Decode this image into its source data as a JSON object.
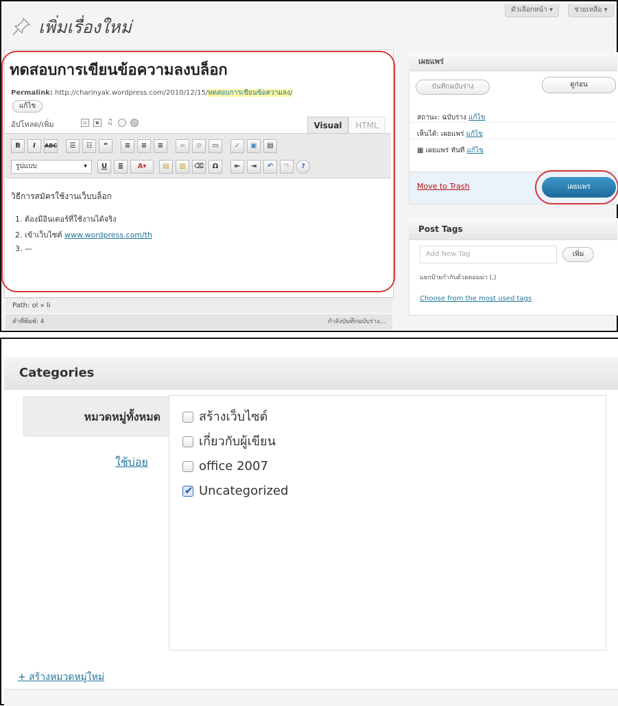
{
  "header": {
    "screen_options_label": "ตัวเลือกหน้า",
    "help_label": "ช่วยเหลือ",
    "page_title": "เพิ่มเรื่องใหม่"
  },
  "editor": {
    "post_title": "ทดสอบการเขียนข้อความลงบล็อก",
    "permalink_label": "Permalink:",
    "permalink_url": "http://charinyak.wordpress.com/2010/12/15/",
    "permalink_slug": "ทดสอบการเขียนข้อความลง/",
    "edit_permalink_label": "แก้ไข",
    "upload_label": "อัปโหลด/เพิ่ม",
    "tab_visual": "Visual",
    "tab_html": "HTML",
    "format_select": "รูปแบบ",
    "body_line1": "วิธีการสมัครใช้งานเว็บบล็อก",
    "list_items": [
      {
        "num": "1.",
        "text": "ต้องมีอินเตอร์ที่ใช้งานได้จริง",
        "link": ""
      },
      {
        "num": "2.",
        "text": "เข้าเว็บไซต์ ",
        "link": "www.wordpress.com/th"
      },
      {
        "num": "3.",
        "text": "—",
        "link": ""
      }
    ],
    "path_label": "Path: ol » li",
    "word_count": "คำที่พิมพ์: 4",
    "draft_status": "กำลังบันทึกฉบับร่าง..."
  },
  "publish": {
    "head": "เผยแพร่",
    "save_draft_label": "บันทึกฉบับร่าง",
    "preview_label": "ดูก่อน",
    "status_line": "สถานะ: ฉบับร่าง",
    "visibility_line": "เห็นได้: เผยแพร่",
    "schedule_line": "เผยแพร่ ทันที",
    "edit_link": "แก้ไข",
    "trash_label": "Move to Trash",
    "publish_label": "เผยแพร่"
  },
  "tags": {
    "head": "Post Tags",
    "input_placeholder": "Add New Tag",
    "add_label": "เพิ่ม",
    "hint": "แยกป้ายกำกับด้วยคอมม่า (,)",
    "most_used_link": "Choose from the most used tags"
  },
  "categories": {
    "head": "Categories",
    "tab_all": "หมวดหมู่ทั้งหมด",
    "tab_popular": "ใช้บ่อย",
    "items": [
      {
        "label": "สร้างเว็บไซต์",
        "checked": false
      },
      {
        "label": "เกี่ยวกับผู้เขียน",
        "checked": false
      },
      {
        "label": "office 2007",
        "checked": false
      },
      {
        "label": "Uncategorized",
        "checked": true
      }
    ],
    "add_new_link": "+ สร้างหมวดหมู่ใหม่"
  },
  "colors": {
    "highlight_red": "#d43838",
    "link_blue": "#21759b",
    "publish_blue": "#2582b8",
    "trash_red": "#bc0b0b"
  }
}
